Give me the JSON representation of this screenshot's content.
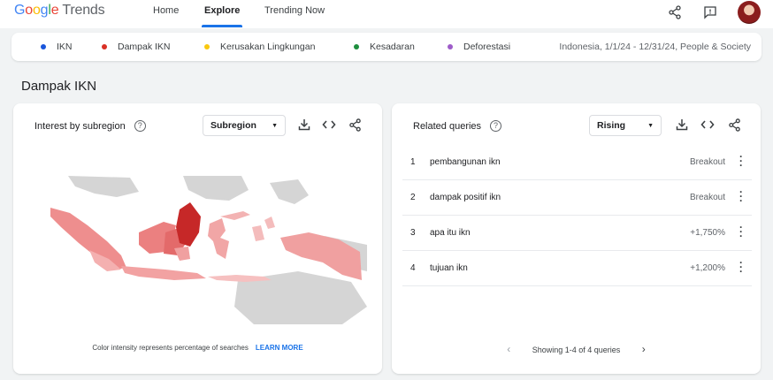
{
  "header": {
    "logo_google": "Google",
    "logo_trends": "Trends",
    "nav": [
      "Home",
      "Explore",
      "Trending Now"
    ]
  },
  "terms": [
    {
      "label": "IKN",
      "color": "#1a56db"
    },
    {
      "label": "Dampak IKN",
      "color": "#d93025"
    },
    {
      "label": "Kerusakan Lingkungan",
      "color": "#f9c80e"
    },
    {
      "label": "Kesadaran",
      "color": "#1e8e3e"
    },
    {
      "label": "Deforestasi",
      "color": "#9e5cc9"
    }
  ],
  "filters": "Indonesia, 1/1/24 - 12/31/24, People & Society",
  "section_title": "Dampak IKN",
  "left_card": {
    "title": "Interest by subregion",
    "help": "?",
    "dropdown": "Subregion",
    "note": "Color intensity represents percentage of searches",
    "learn_more": "LEARN MORE"
  },
  "right_card": {
    "title": "Related queries",
    "help": "?",
    "dropdown": "Rising",
    "queries": [
      {
        "rank": "1",
        "text": "pembangunan ikn",
        "value": "Breakout"
      },
      {
        "rank": "2",
        "text": "dampak positif ikn",
        "value": "Breakout"
      },
      {
        "rank": "3",
        "text": "apa itu ikn",
        "value": "+1,750%"
      },
      {
        "rank": "4",
        "text": "tujuan ikn",
        "value": "+1,200%"
      }
    ],
    "pager": "Showing 1-4 of 4 queries"
  },
  "icons": {
    "share": "share-icon",
    "feedback": "feedback-icon",
    "download": "download-icon",
    "embed": "embed-icon",
    "help": "help-icon"
  }
}
